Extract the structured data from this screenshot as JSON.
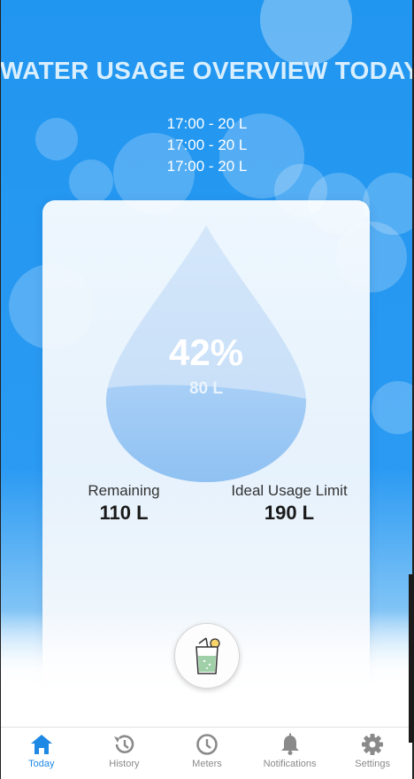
{
  "header": {
    "title": "WATER USAGE OVERVIEW TODAY",
    "log_entries": [
      "17:00 - 20 L",
      "17:00 - 20 L",
      "17:00 - 20 L"
    ]
  },
  "gauge": {
    "percent_text": "42%",
    "volume_text": "80 L",
    "fill_fraction": 0.42
  },
  "stats": {
    "remaining_label": "Remaining",
    "remaining_value": "110 L",
    "limit_label": "Ideal Usage Limit",
    "limit_value": "190 L"
  },
  "add_button": {
    "icon": "drink-glass-icon"
  },
  "nav": {
    "items": [
      {
        "label": "Today",
        "icon": "home-icon",
        "active": true
      },
      {
        "label": "History",
        "icon": "history-icon",
        "active": false
      },
      {
        "label": "Meters",
        "icon": "clock-icon",
        "active": false
      },
      {
        "label": "Notifications",
        "icon": "bell-icon",
        "active": false
      },
      {
        "label": "Settings",
        "icon": "gear-icon",
        "active": false
      }
    ]
  },
  "colors": {
    "background_blue": "#2196f0",
    "active_tab": "#1e88e5",
    "inactive_tab": "#8a8a8a",
    "water": "#9cc8f5"
  }
}
